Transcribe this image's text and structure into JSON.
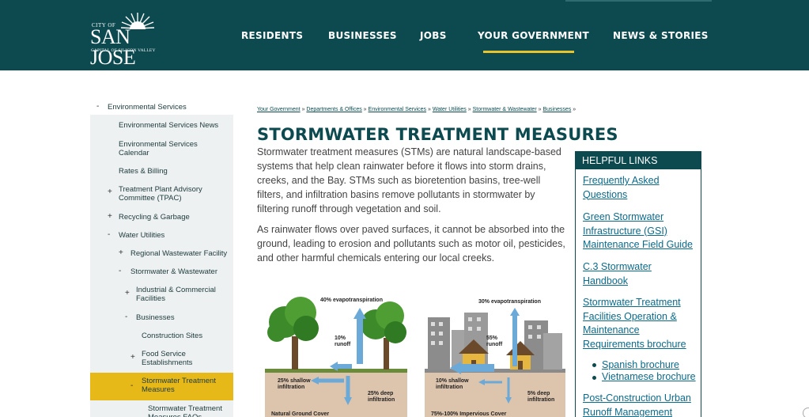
{
  "header": {
    "logo": {
      "city_of": "CITY OF",
      "name": "SAN JOSE",
      "tagline": "CAPITAL OF SILICON VALLEY"
    },
    "nav": [
      {
        "label": "RESIDENTS"
      },
      {
        "label": "BUSINESSES"
      },
      {
        "label": "JOBS"
      },
      {
        "label": "YOUR GOVERNMENT"
      },
      {
        "label": "NEWS & STORIES"
      }
    ]
  },
  "sidebar": {
    "items": [
      {
        "label": "Environmental Services",
        "bullet": "-"
      },
      {
        "label": "Environmental Services News",
        "bullet": ""
      },
      {
        "label": "Environmental Services Calendar",
        "bullet": ""
      },
      {
        "label": "Rates & Billing",
        "bullet": ""
      },
      {
        "label": "Treatment Plant Advisory Committee (TPAC)",
        "bullet": "+"
      },
      {
        "label": "Recycling & Garbage",
        "bullet": "+"
      },
      {
        "label": "Water Utilities",
        "bullet": "-"
      },
      {
        "label": "Regional Wastewater Facility",
        "bullet": "+"
      },
      {
        "label": "Stormwater & Wastewater",
        "bullet": "-"
      },
      {
        "label": "Industrial & Commercial Facilities",
        "bullet": "+"
      },
      {
        "label": "Businesses",
        "bullet": "-"
      },
      {
        "label": "Construction Sites",
        "bullet": ""
      },
      {
        "label": "Food Service Establishments",
        "bullet": "+"
      },
      {
        "label": "Stormwater Treatment Measures",
        "bullet": "-"
      },
      {
        "label": "Stormwater Treatment Measures FAQs",
        "bullet": ""
      }
    ]
  },
  "breadcrumb": {
    "items": [
      "Your Government",
      "Departments & Offices",
      "Environmental Services",
      "Water Utilities",
      "Stormwater & Wastewater",
      "Businesses"
    ],
    "separator": "»"
  },
  "main": {
    "title": "STORMWATER TREATMENT MEASURES",
    "paragraphs": [
      "Stormwater treatment measures (STMs) are natural landscape-based systems that help clean rainwater before it flows into storm drains, creeks, and the Bay. STMs such as bioretention basins, tree-well filters, and infiltration basins remove pollutants in stormwater by filtering runoff through vegetation and soil.",
      "As rainwater flows over paved surfaces, it cannot be absorbed into the ground, leading to erosion and pollutants such as motor oil, pesticides, and other harmful chemicals entering our local creeks."
    ]
  },
  "helpful_links": {
    "header": "HELPFUL LINKS",
    "links": [
      "Frequently Asked Questions",
      "Green Stormwater Infrastructure (GSI) Maintenance Field Guide",
      "C.3 Stormwater Handbook",
      "Stormwater Treatment Facilities Operation & Maintenance Requirements brochure",
      "Post-Construction Urban Runoff Management"
    ],
    "sublinks": [
      "Spanish brochure",
      "Vietnamese brochure"
    ]
  },
  "diagram": {
    "left": {
      "evapotranspiration": "40% evapotranspiration",
      "runoff": "10% runoff",
      "shallow": "25% shallow infiltration",
      "deep": "25% deep infiltration",
      "caption": "Natural Ground Cover"
    },
    "right": {
      "evapotranspiration": "30% evapotranspiration",
      "runoff": "55% runoff",
      "shallow": "10% shallow infiltration",
      "deep": "5% deep infiltration",
      "caption": "75%-100% Impervious Cover"
    }
  },
  "colors": {
    "header_bg": "#0d4a50",
    "accent_yellow": "#e6b919",
    "link_blue": "#0b6a8a",
    "title_teal": "#0d4a50"
  }
}
